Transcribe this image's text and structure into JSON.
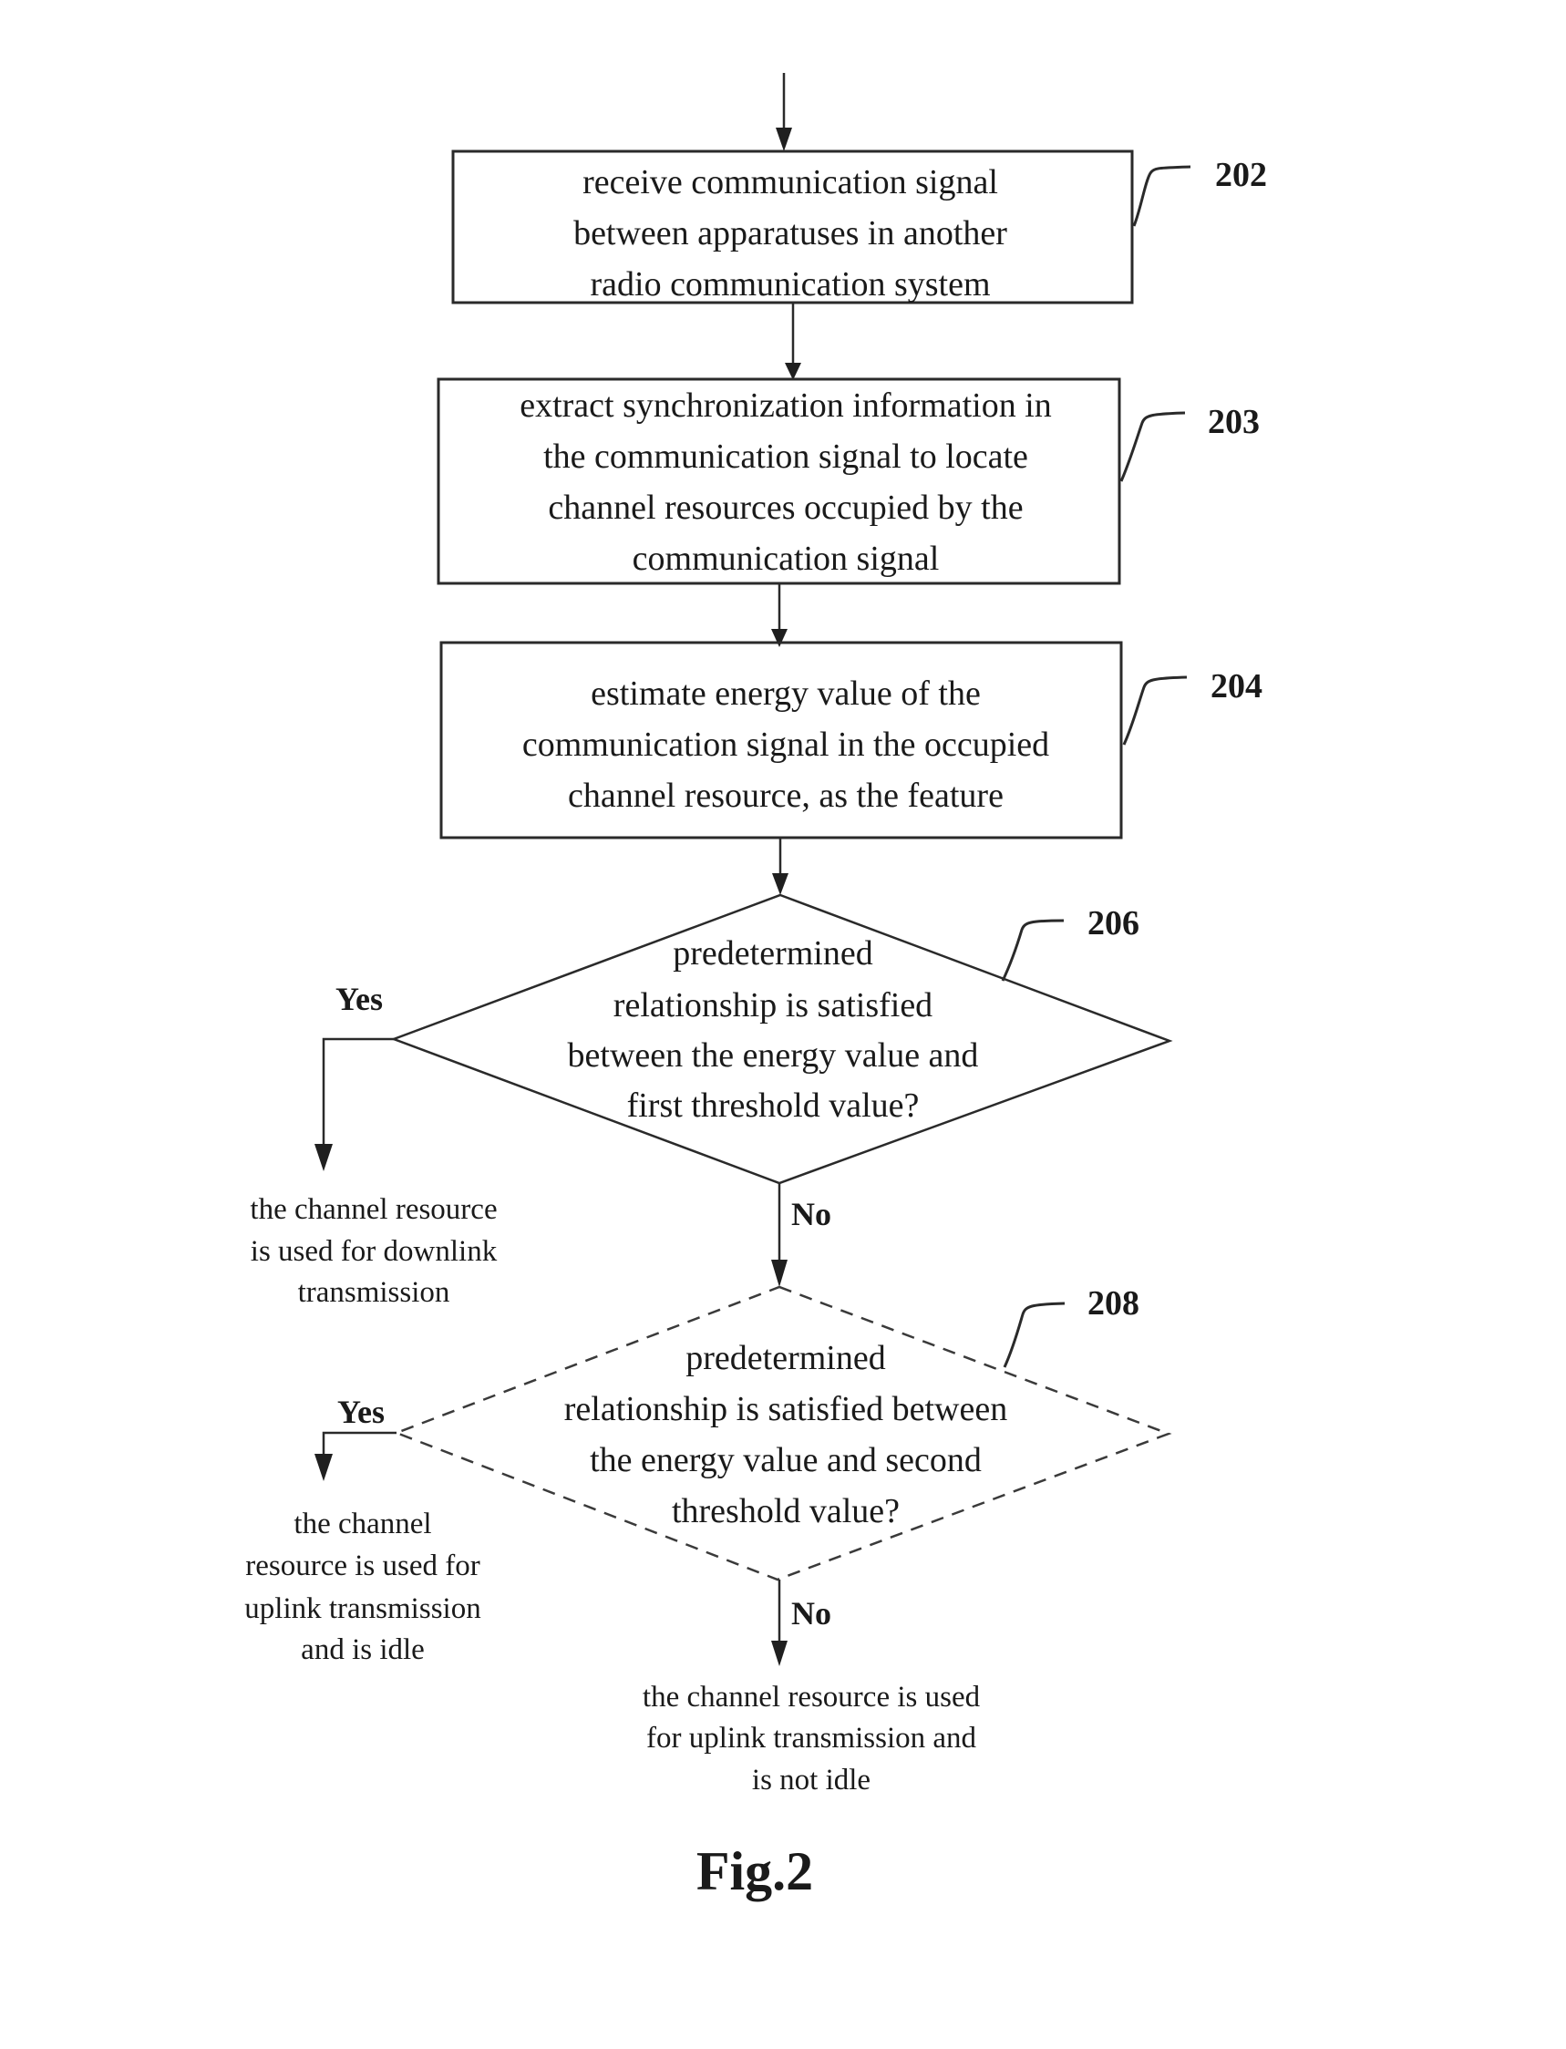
{
  "figure_label": "Fig.2",
  "steps": [
    {
      "id": "202",
      "ref": "202",
      "lines": [
        "receive communication signal",
        "between apparatuses in another",
        "radio communication system"
      ]
    },
    {
      "id": "203",
      "ref": "203",
      "lines": [
        "extract synchronization information in",
        "the communication signal to locate",
        "channel resources occupied by the",
        "communication signal"
      ]
    },
    {
      "id": "204",
      "ref": "204",
      "lines": [
        "estimate energy value of the",
        "communication signal in the occupied",
        "channel resource, as the feature"
      ]
    }
  ],
  "decisions": [
    {
      "id": "206",
      "ref": "206",
      "style": "solid",
      "lines": [
        "predetermined",
        "relationship is satisfied",
        "between the energy value and",
        "first threshold value?"
      ],
      "yes_label": "Yes",
      "no_label": "No"
    },
    {
      "id": "208",
      "ref": "208",
      "style": "dashed",
      "lines": [
        "predetermined",
        "relationship is satisfied between",
        "the energy value and second",
        "threshold value?"
      ],
      "yes_label": "Yes",
      "no_label": "No"
    }
  ],
  "outcomes": {
    "downlink": {
      "lines": [
        "the channel resource",
        "is used for downlink",
        "transmission"
      ]
    },
    "uplink_idle": {
      "lines": [
        "the channel",
        "resource is used for",
        "uplink transmission",
        "and is idle"
      ]
    },
    "uplink_not_idle": {
      "lines": [
        "the channel resource is used",
        "for uplink transmission and",
        "is not idle"
      ]
    }
  }
}
